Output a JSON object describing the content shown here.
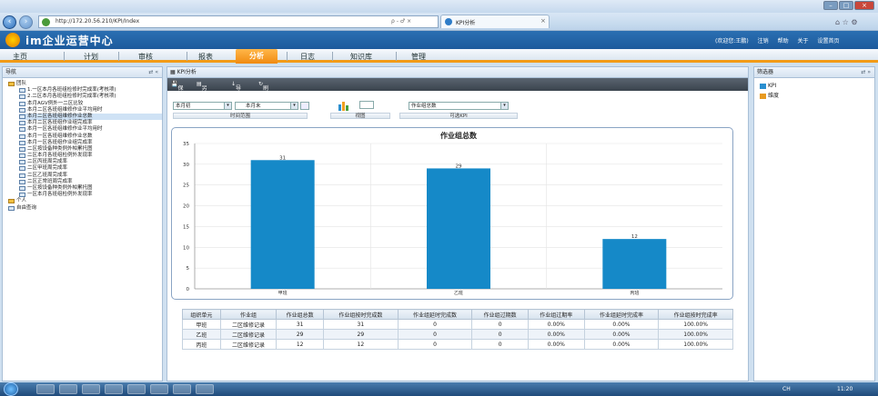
{
  "browser": {
    "url": "http://172.20.56.210/KPI/Index",
    "tab_title": "KPI分析",
    "url_tools": "ρ - ♂ ×"
  },
  "app": {
    "title": "im企业运营中心",
    "header_links": [
      "(欢迎您:王鹏)",
      "注销",
      "帮助",
      "关于",
      "设置首页"
    ]
  },
  "menu": [
    "主页",
    "计划",
    "审核",
    "报表",
    "分析",
    "日志",
    "知识库",
    "管理"
  ],
  "nav": {
    "title": "导航",
    "tree": [
      {
        "label": "团队",
        "level": 0,
        "root": true
      },
      {
        "label": "1.一区本月各班组检修时完成率(考核项)",
        "level": 1
      },
      {
        "label": "2.二区本月各班组检修时完成率(考核项)",
        "level": 1
      },
      {
        "label": "本月AGV例外一二区比较",
        "level": 1
      },
      {
        "label": "本月二区各班组维修作业平均用时",
        "level": 1
      },
      {
        "label": "本月二区各班组维修作业总数",
        "level": 1,
        "selected": true
      },
      {
        "label": "本月二区各班组作业组完成率",
        "level": 1
      },
      {
        "label": "本月一区各班组维修作业平均用时",
        "level": 1
      },
      {
        "label": "本月一区各班组维修作业总数",
        "level": 1
      },
      {
        "label": "本月一区各班组作业组完成率",
        "level": 1
      },
      {
        "label": "二区按设备种类例外帕累托图",
        "level": 1
      },
      {
        "label": "二区本月各班组检例外发现率",
        "level": 1
      },
      {
        "label": "二区丙班周完成率",
        "level": 1
      },
      {
        "label": "二区甲班周完成率",
        "level": 1
      },
      {
        "label": "二区乙班周完成率",
        "level": 1
      },
      {
        "label": "二区正常班周完成率",
        "level": 1
      },
      {
        "label": "一区按设备种类例外帕累托图",
        "level": 1
      },
      {
        "label": "一区本月各班组检例外发现率",
        "level": 1
      },
      {
        "label": "个人",
        "level": 0,
        "root": true
      },
      {
        "label": "自由查询",
        "level": 0
      }
    ]
  },
  "center": {
    "title": "KPI分析",
    "toolbar": [
      "保存",
      "另存为",
      "导出",
      "刷新"
    ],
    "filters": {
      "start": "本月初",
      "end": "本月末",
      "kpi": "作业组总数",
      "caption_time": "时间范围",
      "caption_view": "视图",
      "caption_kpi": "可选KPI"
    }
  },
  "chart_data": {
    "type": "bar",
    "title": "作业组总数",
    "categories": [
      "甲班",
      "乙班",
      "丙班"
    ],
    "values": [
      31,
      29,
      12
    ],
    "ylim": [
      0,
      35
    ],
    "yticks": [
      0,
      5,
      10,
      15,
      20,
      25,
      30,
      35
    ],
    "grid": true,
    "color": "#1589c8"
  },
  "table": {
    "headers": [
      "组织单元",
      "作业组",
      "作业组总数",
      "作业组按时完成数",
      "作业组延时完成数",
      "作业组过期数",
      "作业组过期率",
      "作业组延时完成率",
      "作业组按时完成率"
    ],
    "rows": [
      [
        "甲班",
        "二区维修记录",
        "31",
        "31",
        "0",
        "0",
        "0.00%",
        "0.00%",
        "100.00%"
      ],
      [
        "乙班",
        "二区维修记录",
        "29",
        "29",
        "0",
        "0",
        "0.00%",
        "0.00%",
        "100.00%"
      ],
      [
        "丙班",
        "二区维修记录",
        "12",
        "12",
        "0",
        "0",
        "0.00%",
        "0.00%",
        "100.00%"
      ]
    ]
  },
  "filterpanel": {
    "title": "筛选器",
    "items": [
      "KPI",
      "维度"
    ]
  },
  "taskbar": {
    "clock": "11:20",
    "tray": "CH"
  }
}
